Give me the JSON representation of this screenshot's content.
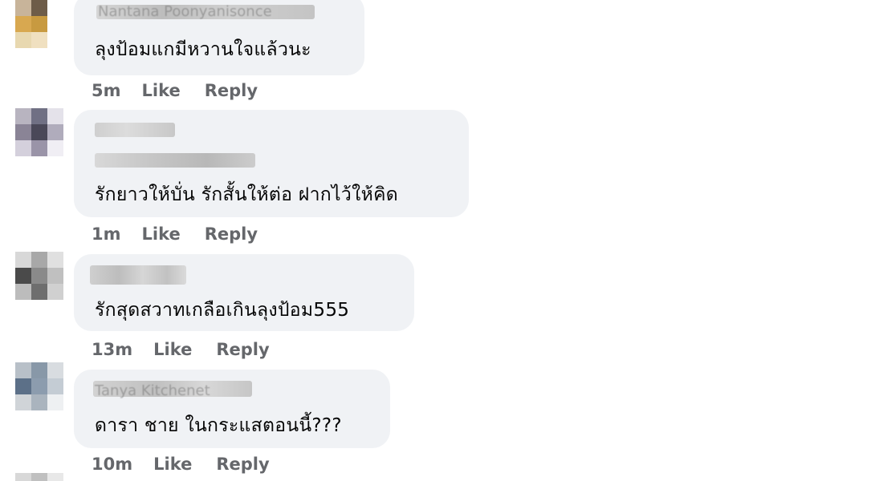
{
  "comments": [
    {
      "author": "Nantana Poonyanisonce",
      "text": "ลุงป้อมแกมีหวานใจแล้วนะ",
      "time": "5m",
      "like_label": "Like",
      "reply_label": "Reply",
      "avatar_colors": [
        "#c8b49a",
        "#6e5c48",
        "#ffffff",
        "#d8a850",
        "#c89a40",
        "#ffffff",
        "#e8d8b0",
        "#f0e0c0",
        "#ffffff"
      ]
    },
    {
      "author": "",
      "text": "รักยาวให้บั่น รักสั้นให้ต่อ ฝากไว้ให้คิด",
      "time": "1m",
      "like_label": "Like",
      "reply_label": "Reply",
      "avatar_colors": [
        "#b8b4c0",
        "#707084",
        "#e4e2ea",
        "#8a8496",
        "#4a4858",
        "#b0acbc",
        "#d4d0dc",
        "#9a94a8",
        "#f0eef4"
      ]
    },
    {
      "author": "",
      "text": "รักสุดสวาทเกลือเกินลุงป้อม555",
      "time": "13m",
      "like_label": "Like",
      "reply_label": "Reply",
      "avatar_colors": [
        "#d8d8d8",
        "#a8a8a8",
        "#e0e0e0",
        "#4a4a4a",
        "#8a8a8a",
        "#c0c0c0",
        "#bcbcbc",
        "#6e6e6e",
        "#d0d0d0"
      ]
    },
    {
      "author": "Tanya Kitchenet",
      "text": "ดารา ชาย ในกระแสตอนนี้???",
      "time": "10m",
      "like_label": "Like",
      "reply_label": "Reply",
      "avatar_colors": [
        "#b8c0c8",
        "#8898a8",
        "#d8dce0",
        "#5c7088",
        "#8c9cae",
        "#c4ccd4",
        "#d0d4d8",
        "#aab4be",
        "#eef0f2"
      ]
    }
  ],
  "bottom_avatar_colors": [
    "#d8d8d8",
    "#c0c0c0",
    "#e8e8e8"
  ]
}
